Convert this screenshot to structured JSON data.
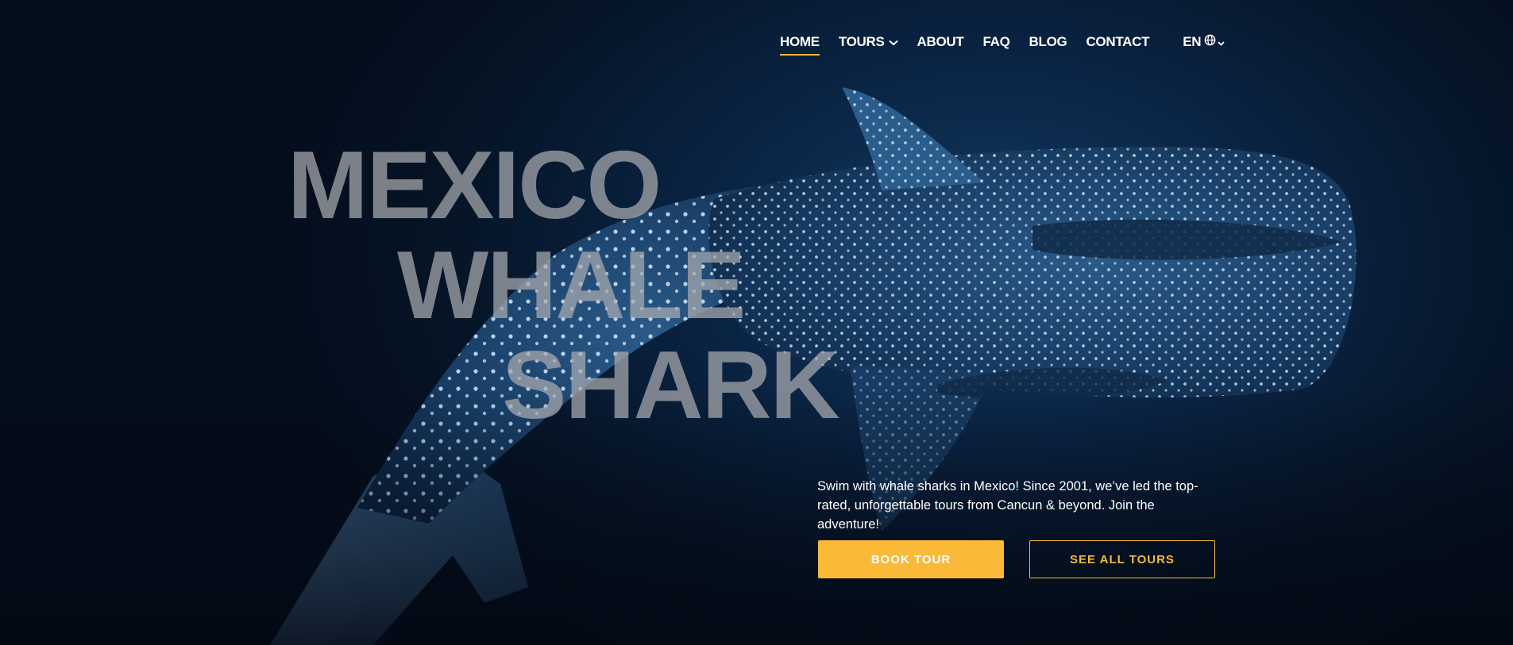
{
  "nav": {
    "items": [
      {
        "label": "HOME",
        "active": true
      },
      {
        "label": "TOURS",
        "has_dropdown": true
      },
      {
        "label": "ABOUT"
      },
      {
        "label": "FAQ"
      },
      {
        "label": "BLOG"
      },
      {
        "label": "CONTACT"
      }
    ],
    "language": {
      "label": "EN",
      "icon": "globe-icon"
    }
  },
  "hero": {
    "title_lines": [
      "MEXICO",
      "WHALE",
      "SHARK"
    ],
    "description": "Swim with whale sharks in Mexico! Since 2001, we’ve led the top-rated, unforgettable tours from Cancun & beyond. Join the adventure!",
    "primary_button": "BOOK TOUR",
    "secondary_button": "SEE ALL TOURS"
  },
  "colors": {
    "accent": "#f6b93b",
    "background": "#061326",
    "title": "#a9abaf"
  }
}
